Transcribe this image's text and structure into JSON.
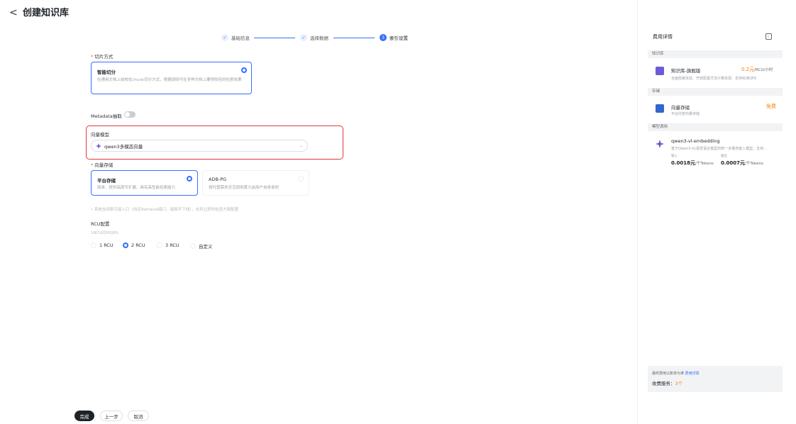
{
  "header": {
    "back_glyph": "<",
    "title": "创建知识库"
  },
  "steps": [
    {
      "label": "基础信息",
      "state": "done",
      "marker": "✓"
    },
    {
      "label": "选择数据",
      "state": "done",
      "marker": "✓"
    },
    {
      "label": "索引设置",
      "state": "active",
      "marker": "3"
    }
  ],
  "chunking": {
    "label": "切片方式",
    "option_title": "智能切分",
    "option_desc": "在通用文档上前校优chunk切分方式，根据调研可在多种文档上要得较佳的检索效果"
  },
  "metadata": {
    "label": "Metadata抽取",
    "enabled": false
  },
  "vector_model": {
    "label": "向量模型",
    "value": "qwen3多模态向量",
    "icon": "model-icon"
  },
  "vector_store": {
    "label": "向量存储",
    "options": [
      {
        "title": "平台存储",
        "desc": "简单、提供高度可扩展、具有高性能检索能力",
        "selected": true
      },
      {
        "title": "ADB-PG",
        "desc": "按托管需求灵活调用算力由用户自身承担",
        "selected": false
      }
    ],
    "note": "• 系统支持索引接入口（向应Retrieval接口、能够不下线），支持立即时检查方面配置"
  },
  "rcu": {
    "label": "RCU配置",
    "desc": "1RCU对50QPS",
    "options": [
      {
        "label": "1 RCU",
        "selected": false
      },
      {
        "label": "2 RCU",
        "selected": true
      },
      {
        "label": "3 RCU",
        "selected": false
      },
      {
        "label": "自定义",
        "selected": false
      }
    ]
  },
  "footer": {
    "finish": "完成",
    "prev": "上一步",
    "cancel": "取消"
  },
  "panel": {
    "title": "费用详情",
    "sections": [
      {
        "name": "知识库",
        "item_title": "知识库-旗舰版",
        "item_desc": "全面检索改造、开放配置灵活计算资源、支持标准QPS",
        "price": "0.2元",
        "price_unit": "/RCU/小时"
      },
      {
        "name": "存储",
        "item_title": "向量存储",
        "item_desc": "平台托管向量存储",
        "price": "免费",
        "price_unit": ""
      },
      {
        "name": "模型调用",
        "item_title": "qwen3-vl-embedding",
        "item_desc": "基于Qwen3-VL视觉语言模型的统一多模态嵌入模型，支持...",
        "price_input_label": "输入",
        "price_output_label": "输出",
        "price_input": "0.0018元",
        "price_input_unit": "/千Tokens",
        "price_output": "0.0007元",
        "price_output_unit": "/千Tokens"
      }
    ],
    "summary_text": "最终费用以账单为准",
    "summary_link": "费用详情",
    "services_label": "收费服务：",
    "services_count": "3个"
  },
  "colors": {
    "accent": "#3370ff",
    "highlight_border": "#e0393e",
    "price": "#ff7d00"
  }
}
